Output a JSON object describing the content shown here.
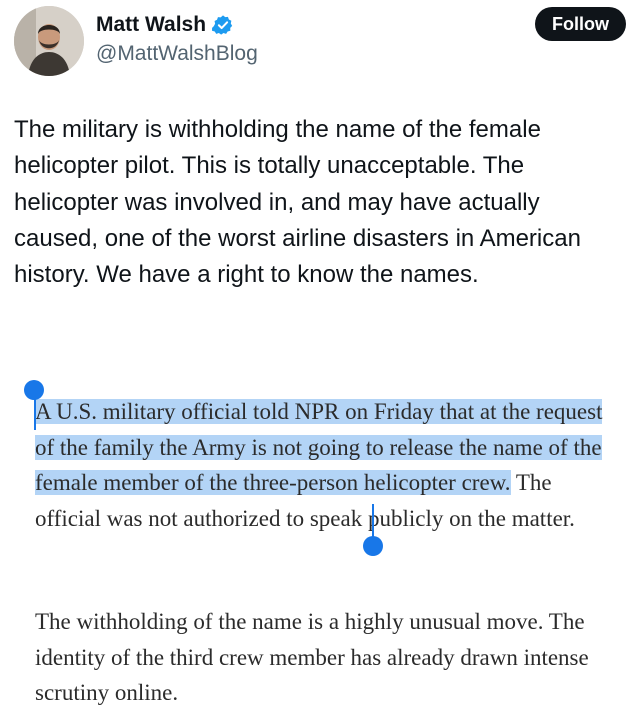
{
  "profile": {
    "name": "Matt Walsh",
    "handle": "@MattWalshBlog",
    "follow_label": "Follow",
    "verified_icon": "verified-badge-icon",
    "verified_color": "#1d9bf0"
  },
  "tweet": {
    "text": "The military is withholding the name of the female helicopter pilot. This is totally unacceptable. The helicopter was involved in, and may have actually caused, one of the worst airline disasters in American history. We have a right to know the names."
  },
  "article": {
    "paragraph1_selected": "A U.S. military official told NPR on Friday that at the request of the family the Army is not going to release the name of the female member of the three-person helicopter crew.",
    "paragraph1_rest": " The official was not authorized to speak publicly on the matter.",
    "paragraph2": "The withholding of the name is a highly unusual move. The identity of the third crew member has already drawn intense scrutiny online.",
    "selection_color": "#b3d4f6",
    "selection_handle_color": "#1877e8"
  }
}
